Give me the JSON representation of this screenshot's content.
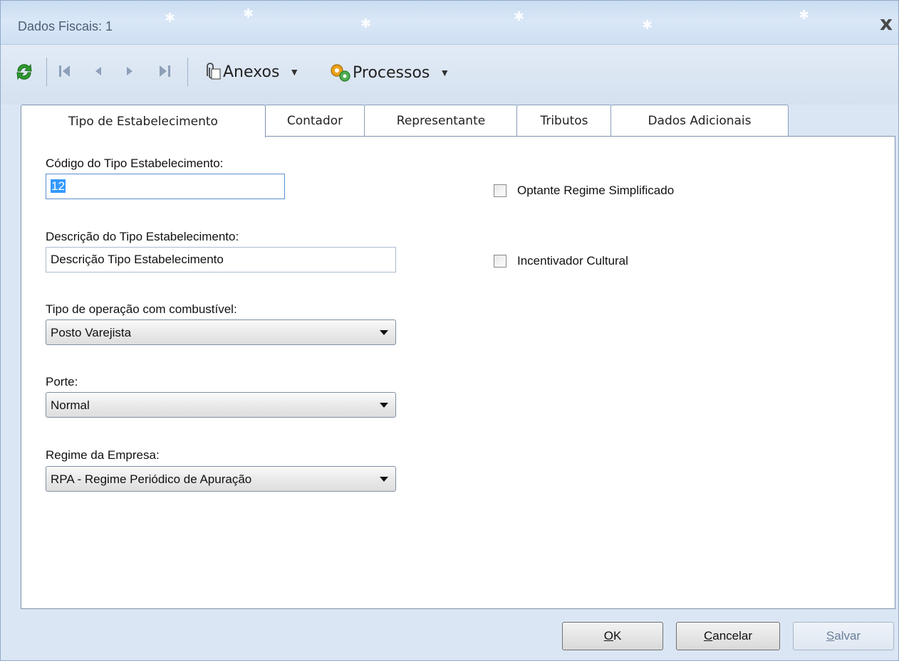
{
  "window": {
    "title": "Dados Fiscais: 1",
    "close_glyph": "x"
  },
  "toolbar": {
    "refresh_icon": "refresh-icon",
    "nav": [
      "first-icon",
      "prev-icon",
      "next-icon",
      "last-icon"
    ],
    "anexos_label": "Anexos",
    "processos_label": "Processos"
  },
  "tabs": [
    {
      "label": "Tipo de Estabelecimento",
      "active": true
    },
    {
      "label": "Contador"
    },
    {
      "label": "Representante"
    },
    {
      "label": "Tributos"
    },
    {
      "label": "Dados Adicionais"
    }
  ],
  "form": {
    "codigo_label": "Código do Tipo Estabelecimento:",
    "codigo_value": "12",
    "descricao_label": "Descrição do Tipo Estabelecimento:",
    "descricao_value": "Descrição Tipo Estabelecimento",
    "operacao_label": "Tipo de operação com combustível:",
    "operacao_value": "Posto Varejista",
    "porte_label": "Porte:",
    "porte_value": "Normal",
    "regime_label": "Regime da Empresa:",
    "regime_value": "RPA - Regime Periódico de Apuração",
    "optante_label": "Optante Regime Simplificado",
    "incentivador_label": "Incentivador Cultural"
  },
  "buttons": {
    "ok_mnemonic": "O",
    "ok_rest": "K",
    "cancel_mnemonic": "C",
    "cancel_rest": "ancelar",
    "save_mnemonic": "S",
    "save_rest": "alvar"
  }
}
